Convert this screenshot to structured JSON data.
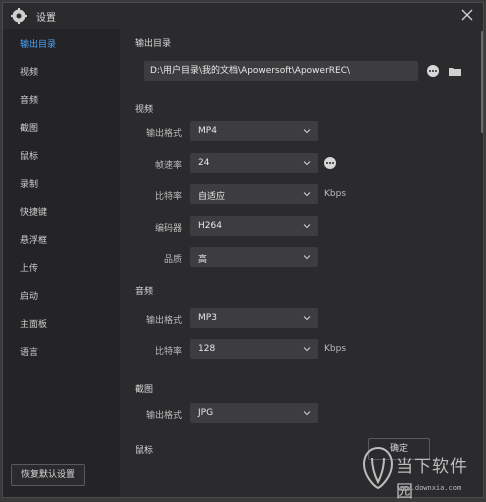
{
  "window": {
    "title": "设置"
  },
  "sidebar": {
    "items": [
      {
        "label": "输出目录",
        "active": true
      },
      {
        "label": "视频"
      },
      {
        "label": "音频"
      },
      {
        "label": "截图"
      },
      {
        "label": "鼠标"
      },
      {
        "label": "录制"
      },
      {
        "label": "快捷键"
      },
      {
        "label": "悬浮框"
      },
      {
        "label": "上传"
      },
      {
        "label": "启动"
      },
      {
        "label": "主面板"
      },
      {
        "label": "语言"
      }
    ],
    "restore_label": "恢复默认设置"
  },
  "output": {
    "section_label": "输出目录",
    "path": "D:\\用户目录\\我的文档\\Apowersoft\\ApowerREC\\"
  },
  "video": {
    "section_label": "视频",
    "format": {
      "label": "输出格式",
      "value": "MP4"
    },
    "framerate": {
      "label": "帧速率",
      "value": "24"
    },
    "bitrate": {
      "label": "比特率",
      "value": "自适应",
      "unit": "Kbps"
    },
    "encoder": {
      "label": "编码器",
      "value": "H264"
    },
    "quality": {
      "label": "品质",
      "value": "高"
    }
  },
  "audio": {
    "section_label": "音频",
    "format": {
      "label": "输出格式",
      "value": "MP3"
    },
    "bitrate": {
      "label": "比特率",
      "value": "128",
      "unit": "Kbps"
    }
  },
  "screenshot": {
    "section_label": "截图",
    "format": {
      "label": "输出格式",
      "value": "JPG"
    }
  },
  "mouse": {
    "section_label": "鼠标"
  },
  "footer": {
    "confirm_label": "确定"
  },
  "watermark": {
    "brand": "当下软件园",
    "url": "www.downxia.com"
  },
  "colors": {
    "accent": "#4aa3ff",
    "background": "#2b2b2e",
    "sidebar": "#242427",
    "field": "#3d3d40"
  }
}
